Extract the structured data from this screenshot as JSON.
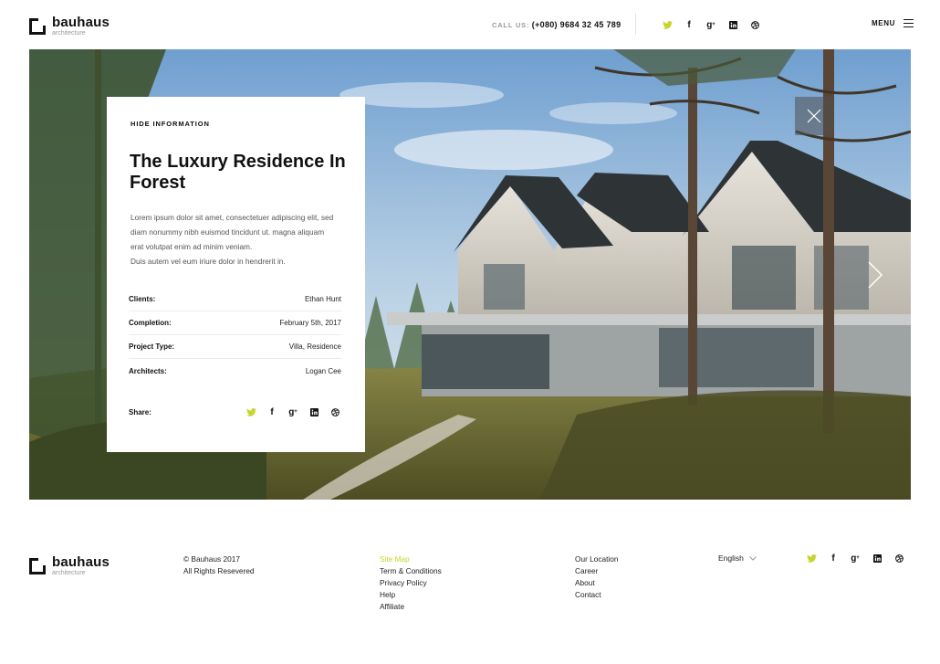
{
  "brand": {
    "name": "bauhaus",
    "tagline": "architecture"
  },
  "header": {
    "call_label": "CALL US:",
    "call_number": "(+080) 9684 32 45 789",
    "menu_label": "MENU"
  },
  "social_icons": [
    "twitter-icon",
    "facebook-icon",
    "google-plus-icon",
    "linkedin-icon",
    "dribbble-icon"
  ],
  "colors": {
    "accent": "#c7d42a",
    "text": "#111111",
    "muted": "#9a9a9a"
  },
  "project": {
    "hide_label": "HIDE INFORMATION",
    "title": "The Luxury Residence In Forest",
    "description": [
      "Lorem ipsum dolor sit amet, consectetuer adipiscing elit, sed",
      "diam nonummy nibh euismod tincidunt ut. magna aliquam",
      "erat volutpat  enim ad minim veniam.",
      "Duis autem vel eum iriure dolor in hendrerit in."
    ],
    "details": [
      {
        "label": "Clients:",
        "value": "Ethan Hunt"
      },
      {
        "label": "Completion:",
        "value": "February 5th, 2017"
      },
      {
        "label": "Project Type:",
        "value": "Villa, Residence"
      },
      {
        "label": "Architects:",
        "value": "Logan Cee"
      }
    ],
    "share_label": "Share:"
  },
  "footer": {
    "copyright": "© Bauhaus 2017",
    "rights": "All Rights Resevered",
    "links_col1": [
      "Site Map",
      "Term & Conditions",
      "Privacy Policy",
      "Help",
      "Affiliate"
    ],
    "links_col2": [
      "Our Location",
      "Career",
      "About",
      "Contact"
    ],
    "language": "English"
  }
}
